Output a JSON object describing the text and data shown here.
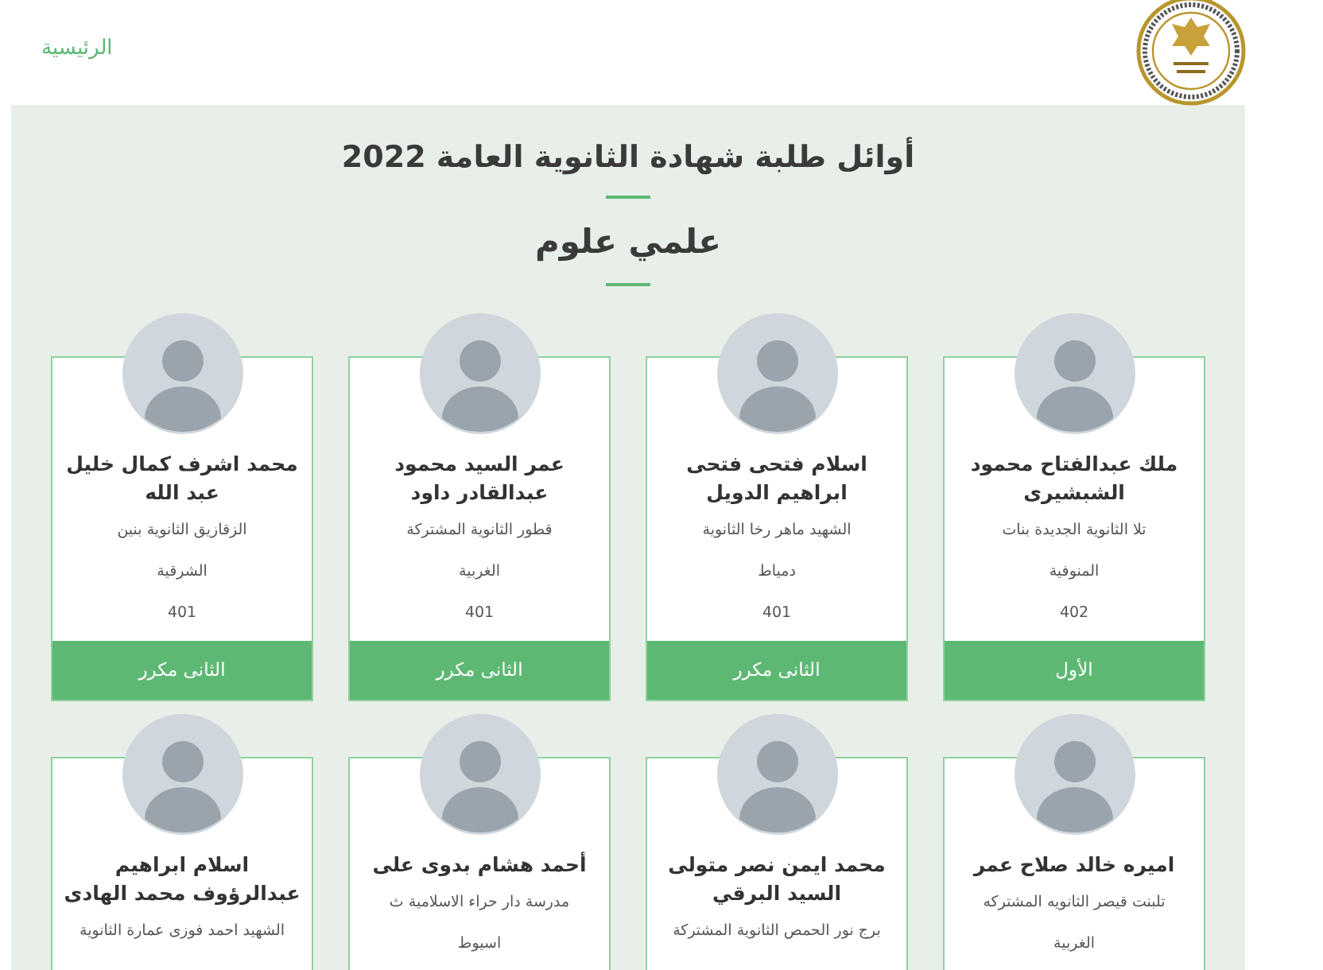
{
  "nav": {
    "home_link": "الرئيسية"
  },
  "title": "أوائل طلبة شهادة الثانوية العامة 2022",
  "subtitle": "علمي علوم",
  "students": [
    {
      "name": "ملك عبدالفتاح محمود الشبشيرى",
      "school": "تلا الثانوية الجديدة بنات",
      "governorate": "المنوفية",
      "score": "402",
      "rank": "الأول"
    },
    {
      "name": "اسلام فتحى فتحى ابراهيم الدويل",
      "school": "الشهيد ماهر رخا الثانوية",
      "governorate": "دمياط",
      "score": "401",
      "rank": "الثانى مكرر"
    },
    {
      "name": "عمر السيد محمود عبدالقادر داود",
      "school": "قطور الثانوية المشتركة",
      "governorate": "الغربية",
      "score": "401",
      "rank": "الثانى مكرر"
    },
    {
      "name": "محمد اشرف كمال خليل عبد الله",
      "school": "الزقازيق الثانوية بنين",
      "governorate": "الشرقية",
      "score": "401",
      "rank": "الثانى مكرر"
    },
    {
      "name": "اميره خالد صلاح عمر",
      "school": "تلبنت قيصر الثانويه المشتركه",
      "governorate": "الغربية"
    },
    {
      "name": "محمد ايمن نصر متولى السيد البرقي",
      "school": "برج نور الحمص الثانوية المشتركة"
    },
    {
      "name": "أحمد هشام بدوى على",
      "school": "مدرسة دار حراء الاسلامية ث",
      "governorate": "اسيوط"
    },
    {
      "name": "اسلام ابراهيم عبدالرؤوف محمد الهادى",
      "school": "الشهيد احمد فوزى عمارة الثانوية"
    }
  ]
}
